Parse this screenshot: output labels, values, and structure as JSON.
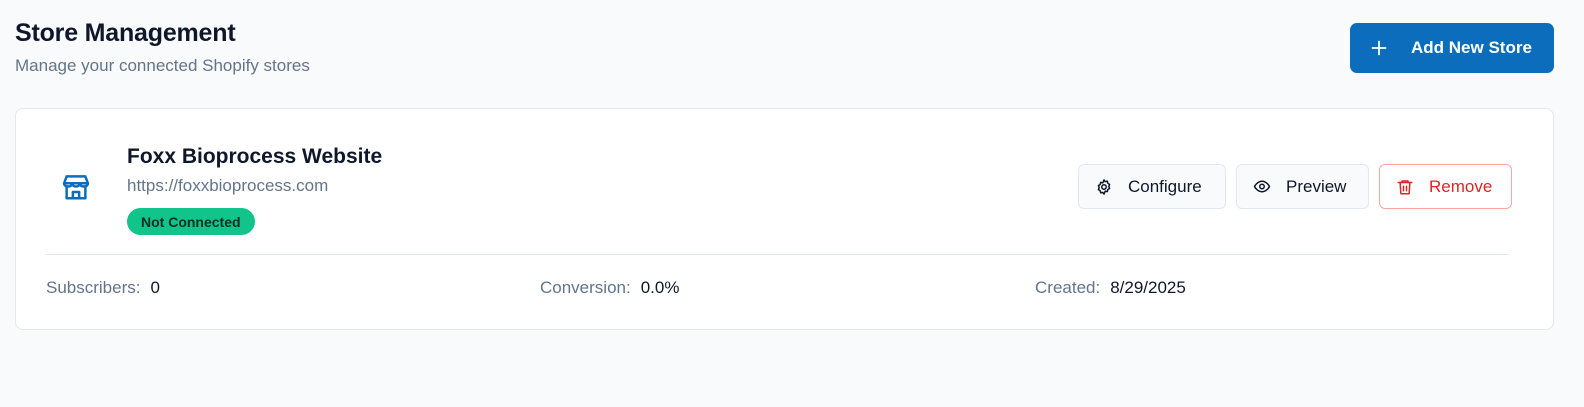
{
  "header": {
    "title": "Store Management",
    "subtitle": "Manage your connected Shopify stores",
    "add_button_label": "Add New Store",
    "add_button_icon": "plus-icon"
  },
  "colors": {
    "primary": "#0b6dbb",
    "status_not_connected": "#10c48a",
    "danger": "#dc2626",
    "muted_text": "#64748b"
  },
  "store": {
    "icon": "store-icon",
    "name": "Foxx Bioprocess Website",
    "url": "https://foxxbioprocess.com",
    "status": "Not Connected",
    "actions": {
      "configure": {
        "label": "Configure",
        "icon": "gear-icon"
      },
      "preview": {
        "label": "Preview",
        "icon": "eye-icon"
      },
      "remove": {
        "label": "Remove",
        "icon": "trash-icon"
      }
    },
    "stats": {
      "subscribers": {
        "label": "Subscribers:",
        "value": "0"
      },
      "conversion": {
        "label": "Conversion:",
        "value": "0.0%"
      },
      "created": {
        "label": "Created:",
        "value": "8/29/2025"
      }
    }
  }
}
